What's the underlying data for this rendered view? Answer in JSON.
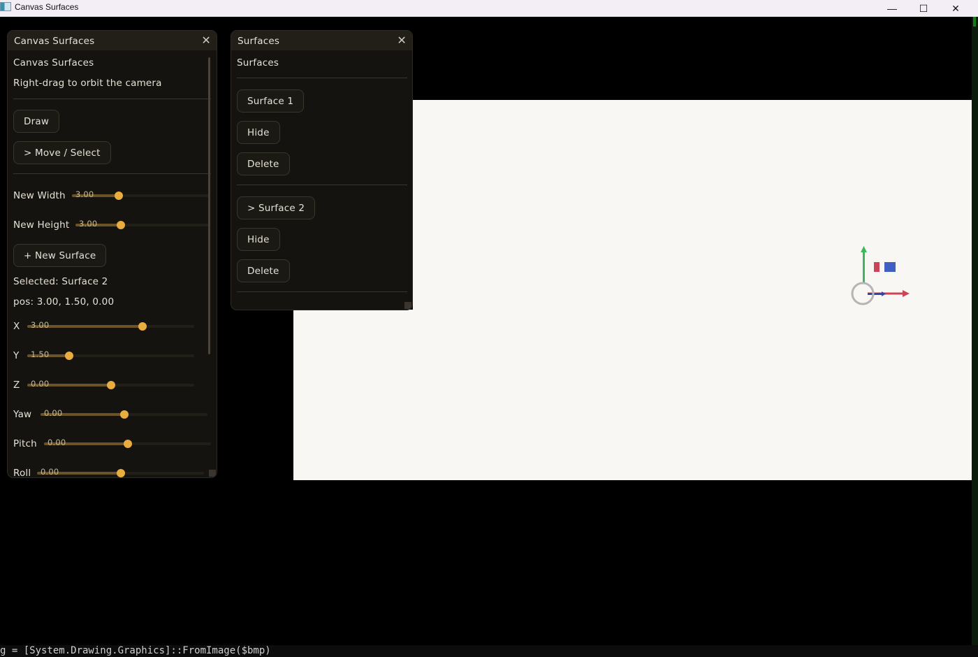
{
  "window": {
    "title": "Canvas Surfaces",
    "minimize_glyph": "—",
    "maximize_glyph": "☐",
    "close_glyph": "✕"
  },
  "left_panel": {
    "title": "Canvas Surfaces",
    "heading": "Canvas Surfaces",
    "hint": "Right-drag to orbit the camera",
    "draw_button": "Draw",
    "move_select_button": "> Move / Select",
    "new_width": {
      "label": "New Width",
      "value": "3.00",
      "fraction": 0.34
    },
    "new_height": {
      "label": "New Height",
      "value": "3.00",
      "fraction": 0.34
    },
    "new_surface_button": "+ New Surface",
    "selected_text": "Selected: Surface 2",
    "pos_text": "pos: 3.00, 1.50, 0.00",
    "sliders": {
      "x": {
        "label": "X",
        "value": "3.00",
        "fraction": 0.69
      },
      "y": {
        "label": "Y",
        "value": "1.50",
        "fraction": 0.25
      },
      "z": {
        "label": "Z",
        "value": "0.00",
        "fraction": 0.5
      },
      "yaw": {
        "label": "Yaw",
        "value": "0.00",
        "fraction": 0.5
      },
      "pitch": {
        "label": "Pitch",
        "value": "0.00",
        "fraction": 0.5
      },
      "roll": {
        "label": "Roll",
        "value": "0.00",
        "fraction": 0.5
      }
    }
  },
  "right_panel": {
    "title": "Surfaces",
    "heading": "Surfaces",
    "items": [
      {
        "label": "Surface 1",
        "hide": "Hide",
        "delete": "Delete"
      },
      {
        "label": "> Surface 2",
        "hide": "Hide",
        "delete": "Delete"
      }
    ]
  },
  "console": {
    "text": "g = [System.Drawing.Graphics]::FromImage($bmp)"
  },
  "colors": {
    "accent": "#e9ad3f",
    "gizmo_y": "#3cb85a",
    "gizmo_x": "#cc4455",
    "gizmo_z": "#3344aa",
    "plane_red": "#c8455a",
    "plane_blue": "#3e5fc4"
  }
}
